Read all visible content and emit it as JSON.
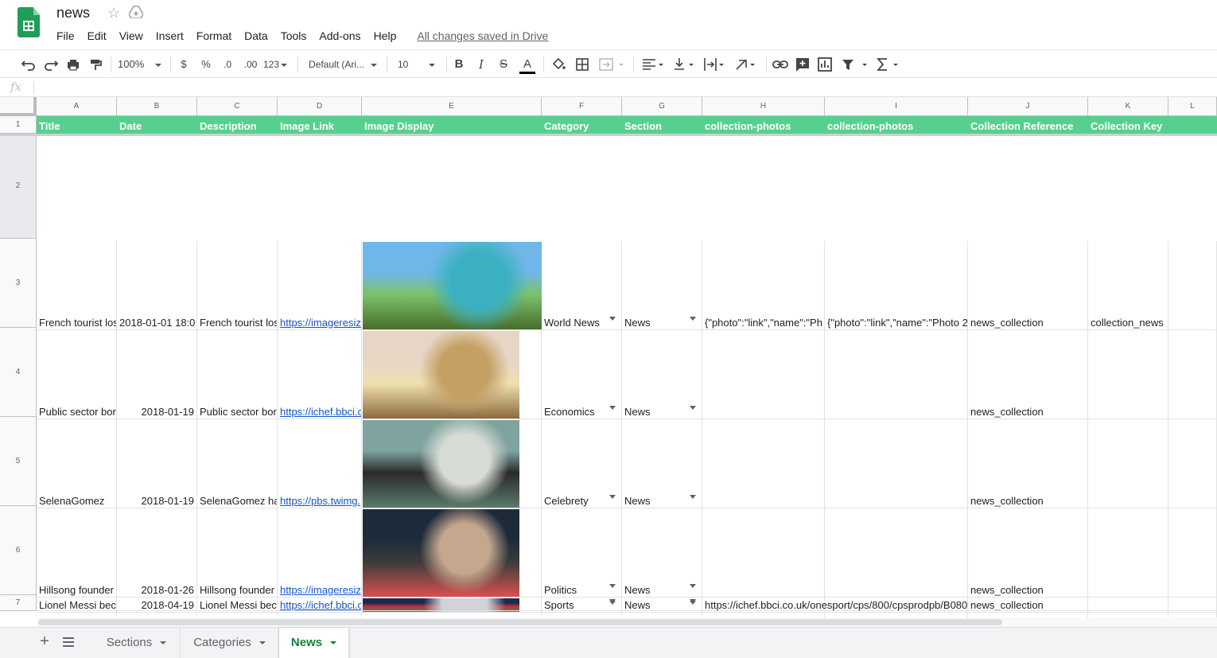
{
  "app": {
    "doc_title": "news",
    "save_status": "All changes saved in Drive",
    "icons": {
      "logo": "sheets-logo-icon",
      "star": "star-icon",
      "drive": "move-to-drive-icon"
    }
  },
  "menu": [
    "File",
    "Edit",
    "View",
    "Insert",
    "Format",
    "Data",
    "Tools",
    "Add-ons",
    "Help"
  ],
  "toolbar": {
    "zoom": "100%",
    "currency": "$",
    "percent": "%",
    "decrease_decimals": ".0",
    "increase_decimals": ".00",
    "more_formats": "123",
    "font": "Default (Ari...",
    "font_size": "10",
    "accent_text_color": "#000000"
  },
  "formula_bar": {
    "fx": "fx",
    "value": ""
  },
  "grid": {
    "columns": [
      "A",
      "B",
      "C",
      "D",
      "E",
      "F",
      "G",
      "H",
      "I",
      "J",
      "K",
      "L"
    ],
    "row_numbers": [
      "1",
      "2",
      "3",
      "4",
      "5",
      "6",
      "7"
    ],
    "header_row": [
      "Title",
      "Date",
      "Description",
      "Image Link",
      "Image Display",
      "Category",
      "Section",
      "collection-photos",
      "collection-photos",
      "Collection Reference",
      "Collection Key",
      ""
    ],
    "header_color": "#57d08f",
    "rows": [
      {
        "title": "French tourist los",
        "date": "2018-01-01 18:0",
        "description": "French tourist los",
        "image_link": "https://imageresiz",
        "category": "World News",
        "section": "News",
        "photos_1": "{\"photo\":\"link\",\"name\":\"Ph",
        "photos_2": "{\"photo\":\"link\",\"name\":\"Photo 2",
        "collection_ref": "news_collection",
        "collection_key": "collection_news",
        "image_alt": "tropical-lagoon-photo"
      },
      {
        "title": "Public sector bor",
        "date": "2018-01-19",
        "description": "Public sector bor",
        "image_link": "https://ichef.bbci.c",
        "category": "Economics",
        "section": "News",
        "photos_1": "",
        "photos_2": "",
        "collection_ref": "news_collection",
        "collection_key": "",
        "image_alt": "pound-coin-photo"
      },
      {
        "title": "SelenaGomez",
        "date": "2018-01-19",
        "description": "SelenaGomez ha",
        "image_link": "https://pbs.twimg.",
        "category": "Celebrety",
        "section": "News",
        "photos_1": "",
        "photos_2": "",
        "collection_ref": "news_collection",
        "collection_key": "",
        "image_alt": "portrait-photo"
      },
      {
        "title": "Hillsong founder",
        "date": "2018-01-26",
        "description": "Hillsong founder",
        "image_link": "https://imageresiz",
        "category": "Politics",
        "section": "News",
        "photos_1": "",
        "photos_2": "",
        "collection_ref": "news_collection",
        "collection_key": "",
        "image_alt": "radio-interview-photo"
      },
      {
        "title": "Lionel Messi bec",
        "date": "2018-04-19",
        "description": "Lionel Messi bec",
        "image_link": "https://ichef.bbci.c",
        "category": "Sports",
        "section": "News",
        "photos_1": "https://ichef.bbci.co.uk/onesport/cps/800/cpsprodpb/B080",
        "photos_2": "",
        "collection_ref": "news_collection",
        "collection_key": "",
        "image_alt": "football-match-photo"
      }
    ]
  },
  "sheets": {
    "add_label": "+",
    "tabs": [
      {
        "label": "Sections",
        "active": false
      },
      {
        "label": "Categories",
        "active": false
      },
      {
        "label": "News",
        "active": true
      }
    ]
  }
}
